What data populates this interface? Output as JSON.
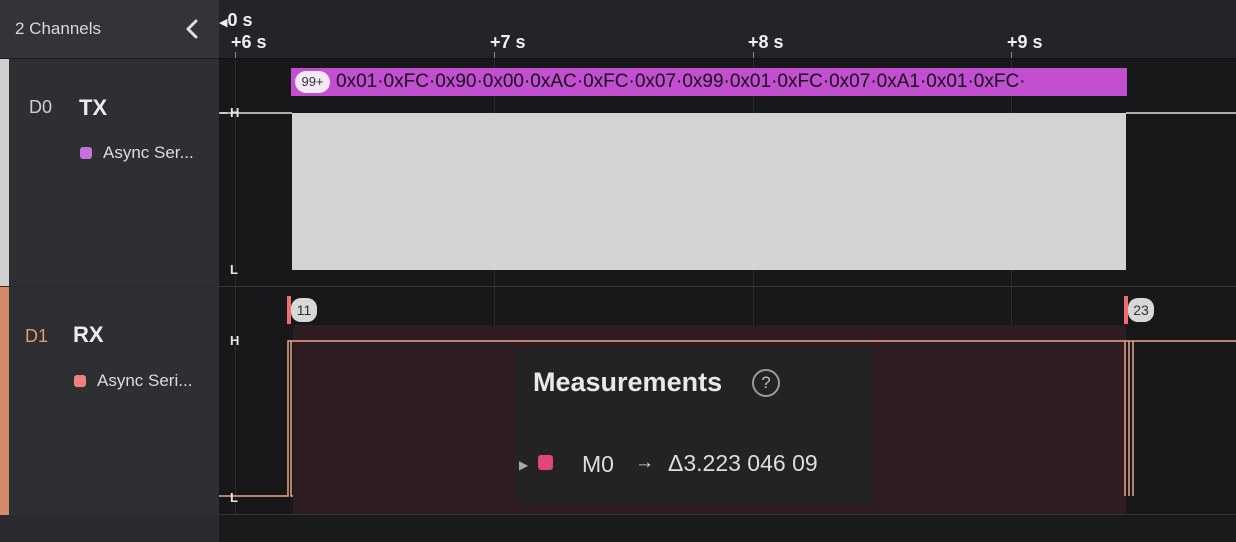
{
  "sidebar": {
    "channels_count": "2 Channels",
    "channels": [
      {
        "id": "D0",
        "name": "TX",
        "analyzer": "Async Ser...",
        "analyzer_color": "#c870e0",
        "strip_color": "#cfcfcf",
        "id_color": "#cfcfcf"
      },
      {
        "id": "D1",
        "name": "RX",
        "analyzer": "Async Seri...",
        "analyzer_color": "#f08080",
        "strip_color": "#d4896a",
        "id_color": "#e09a76"
      }
    ]
  },
  "timeline": {
    "origin": "0 s",
    "ticks": [
      "+6 s",
      "+7 s",
      "+8 s",
      "+9 s"
    ]
  },
  "waveform": {
    "tx": {
      "high_label": "H",
      "low_label": "L",
      "more_badge": "99+",
      "bytes_text": "0x01·0xFC·0x90·0x00·0xAC·0xFC·0x07·0x99·0x01·0xFC·0x07·0xA1·0x01·0xFC·"
    },
    "rx": {
      "high_label": "H",
      "low_label": "L",
      "marker_start": "11",
      "marker_end": "23"
    }
  },
  "measurements": {
    "title": "Measurements",
    "help": "?",
    "items": [
      {
        "name": "M0",
        "arrow": "→",
        "value": "Δ3.223 046 09",
        "color": "#e0457b"
      }
    ]
  }
}
